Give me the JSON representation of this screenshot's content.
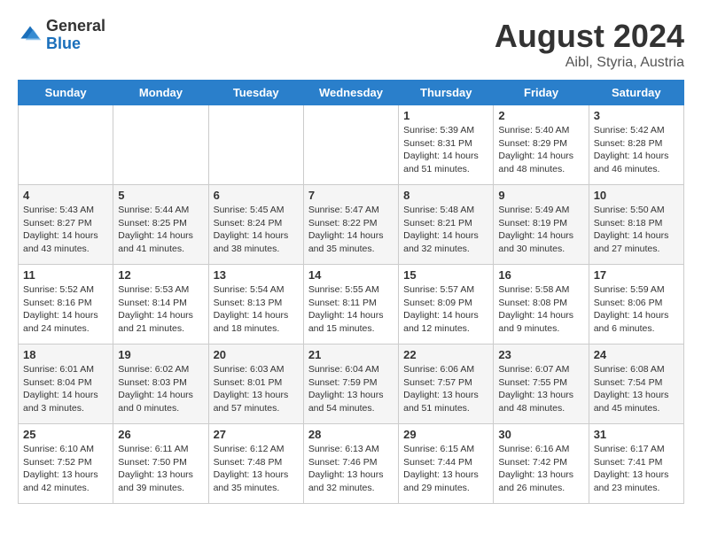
{
  "header": {
    "logo_general": "General",
    "logo_blue": "Blue",
    "month_year": "August 2024",
    "location": "Aibl, Styria, Austria"
  },
  "weekdays": [
    "Sunday",
    "Monday",
    "Tuesday",
    "Wednesday",
    "Thursday",
    "Friday",
    "Saturday"
  ],
  "weeks": [
    [
      {
        "day": "",
        "content": ""
      },
      {
        "day": "",
        "content": ""
      },
      {
        "day": "",
        "content": ""
      },
      {
        "day": "",
        "content": ""
      },
      {
        "day": "1",
        "content": "Sunrise: 5:39 AM\nSunset: 8:31 PM\nDaylight: 14 hours and 51 minutes."
      },
      {
        "day": "2",
        "content": "Sunrise: 5:40 AM\nSunset: 8:29 PM\nDaylight: 14 hours and 48 minutes."
      },
      {
        "day": "3",
        "content": "Sunrise: 5:42 AM\nSunset: 8:28 PM\nDaylight: 14 hours and 46 minutes."
      }
    ],
    [
      {
        "day": "4",
        "content": "Sunrise: 5:43 AM\nSunset: 8:27 PM\nDaylight: 14 hours and 43 minutes."
      },
      {
        "day": "5",
        "content": "Sunrise: 5:44 AM\nSunset: 8:25 PM\nDaylight: 14 hours and 41 minutes."
      },
      {
        "day": "6",
        "content": "Sunrise: 5:45 AM\nSunset: 8:24 PM\nDaylight: 14 hours and 38 minutes."
      },
      {
        "day": "7",
        "content": "Sunrise: 5:47 AM\nSunset: 8:22 PM\nDaylight: 14 hours and 35 minutes."
      },
      {
        "day": "8",
        "content": "Sunrise: 5:48 AM\nSunset: 8:21 PM\nDaylight: 14 hours and 32 minutes."
      },
      {
        "day": "9",
        "content": "Sunrise: 5:49 AM\nSunset: 8:19 PM\nDaylight: 14 hours and 30 minutes."
      },
      {
        "day": "10",
        "content": "Sunrise: 5:50 AM\nSunset: 8:18 PM\nDaylight: 14 hours and 27 minutes."
      }
    ],
    [
      {
        "day": "11",
        "content": "Sunrise: 5:52 AM\nSunset: 8:16 PM\nDaylight: 14 hours and 24 minutes."
      },
      {
        "day": "12",
        "content": "Sunrise: 5:53 AM\nSunset: 8:14 PM\nDaylight: 14 hours and 21 minutes."
      },
      {
        "day": "13",
        "content": "Sunrise: 5:54 AM\nSunset: 8:13 PM\nDaylight: 14 hours and 18 minutes."
      },
      {
        "day": "14",
        "content": "Sunrise: 5:55 AM\nSunset: 8:11 PM\nDaylight: 14 hours and 15 minutes."
      },
      {
        "day": "15",
        "content": "Sunrise: 5:57 AM\nSunset: 8:09 PM\nDaylight: 14 hours and 12 minutes."
      },
      {
        "day": "16",
        "content": "Sunrise: 5:58 AM\nSunset: 8:08 PM\nDaylight: 14 hours and 9 minutes."
      },
      {
        "day": "17",
        "content": "Sunrise: 5:59 AM\nSunset: 8:06 PM\nDaylight: 14 hours and 6 minutes."
      }
    ],
    [
      {
        "day": "18",
        "content": "Sunrise: 6:01 AM\nSunset: 8:04 PM\nDaylight: 14 hours and 3 minutes."
      },
      {
        "day": "19",
        "content": "Sunrise: 6:02 AM\nSunset: 8:03 PM\nDaylight: 14 hours and 0 minutes."
      },
      {
        "day": "20",
        "content": "Sunrise: 6:03 AM\nSunset: 8:01 PM\nDaylight: 13 hours and 57 minutes."
      },
      {
        "day": "21",
        "content": "Sunrise: 6:04 AM\nSunset: 7:59 PM\nDaylight: 13 hours and 54 minutes."
      },
      {
        "day": "22",
        "content": "Sunrise: 6:06 AM\nSunset: 7:57 PM\nDaylight: 13 hours and 51 minutes."
      },
      {
        "day": "23",
        "content": "Sunrise: 6:07 AM\nSunset: 7:55 PM\nDaylight: 13 hours and 48 minutes."
      },
      {
        "day": "24",
        "content": "Sunrise: 6:08 AM\nSunset: 7:54 PM\nDaylight: 13 hours and 45 minutes."
      }
    ],
    [
      {
        "day": "25",
        "content": "Sunrise: 6:10 AM\nSunset: 7:52 PM\nDaylight: 13 hours and 42 minutes."
      },
      {
        "day": "26",
        "content": "Sunrise: 6:11 AM\nSunset: 7:50 PM\nDaylight: 13 hours and 39 minutes."
      },
      {
        "day": "27",
        "content": "Sunrise: 6:12 AM\nSunset: 7:48 PM\nDaylight: 13 hours and 35 minutes."
      },
      {
        "day": "28",
        "content": "Sunrise: 6:13 AM\nSunset: 7:46 PM\nDaylight: 13 hours and 32 minutes."
      },
      {
        "day": "29",
        "content": "Sunrise: 6:15 AM\nSunset: 7:44 PM\nDaylight: 13 hours and 29 minutes."
      },
      {
        "day": "30",
        "content": "Sunrise: 6:16 AM\nSunset: 7:42 PM\nDaylight: 13 hours and 26 minutes."
      },
      {
        "day": "31",
        "content": "Sunrise: 6:17 AM\nSunset: 7:41 PM\nDaylight: 13 hours and 23 minutes."
      }
    ]
  ]
}
